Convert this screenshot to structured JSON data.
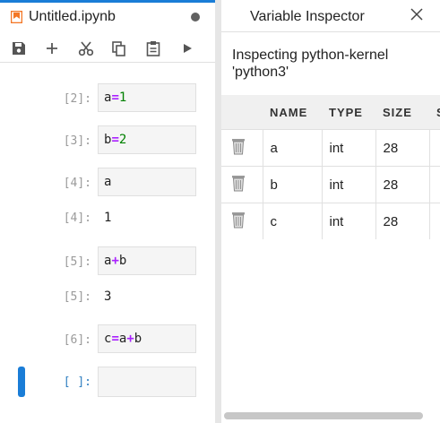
{
  "notebook": {
    "tab_title": "Untitled.ipynb",
    "toolbar": {
      "icons": [
        "save-icon",
        "add-icon",
        "cut-icon",
        "copy-icon",
        "paste-icon",
        "run-icon"
      ]
    },
    "cells": [
      {
        "prompt": "[2]:",
        "code": [
          {
            "t": "a",
            "c": "id"
          },
          {
            "t": "=",
            "c": "op"
          },
          {
            "t": "1",
            "c": "num"
          }
        ]
      },
      {
        "prompt": "[3]:",
        "code": [
          {
            "t": "b",
            "c": "id"
          },
          {
            "t": "=",
            "c": "op"
          },
          {
            "t": "2",
            "c": "num"
          }
        ]
      },
      {
        "prompt": "[4]:",
        "code": [
          {
            "t": "a",
            "c": "id"
          }
        ],
        "out_prompt": "[4]:",
        "output": "1"
      },
      {
        "prompt": "[5]:",
        "code": [
          {
            "t": "a",
            "c": "id"
          },
          {
            "t": "+",
            "c": "op"
          },
          {
            "t": "b",
            "c": "id"
          }
        ],
        "out_prompt": "[5]:",
        "output": "3"
      },
      {
        "prompt": "[6]:",
        "code": [
          {
            "t": "c",
            "c": "id"
          },
          {
            "t": "=",
            "c": "op"
          },
          {
            "t": "a",
            "c": "id"
          },
          {
            "t": "+",
            "c": "op"
          },
          {
            "t": "b",
            "c": "id"
          }
        ]
      },
      {
        "prompt": "[ ]:",
        "code": [],
        "active": true
      }
    ],
    "colors": {
      "accent": "#1a7dd7",
      "tab_icon": "#f37726",
      "operator": "#aa22ff",
      "number": "#008000"
    }
  },
  "inspector": {
    "tab_title": "Variable Inspector",
    "description": "Inspecting python-kernel 'python3'",
    "columns": [
      "NAME",
      "TYPE",
      "SIZE",
      "S"
    ],
    "rows": [
      {
        "name": "a",
        "type": "int",
        "size": "28"
      },
      {
        "name": "b",
        "type": "int",
        "size": "28"
      },
      {
        "name": "c",
        "type": "int",
        "size": "28"
      }
    ]
  }
}
